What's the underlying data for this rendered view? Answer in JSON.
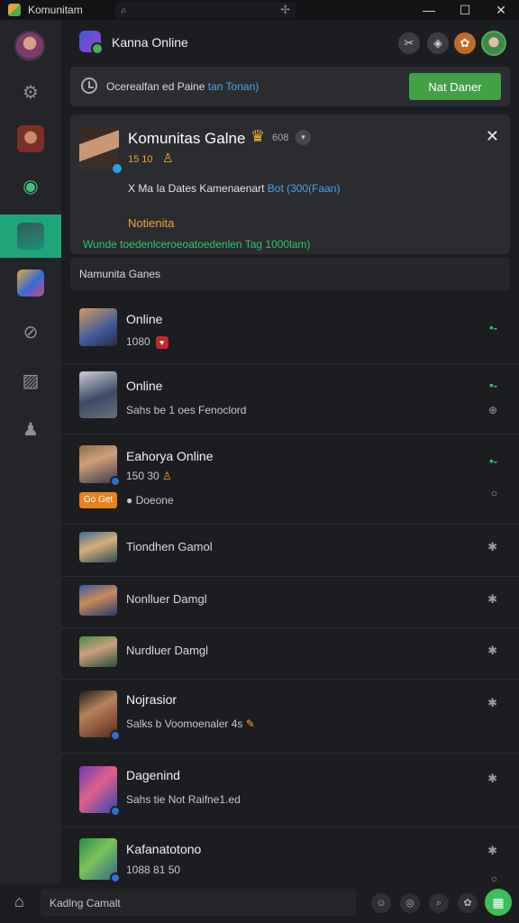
{
  "window": {
    "title": "Komunitam",
    "controls": [
      "—",
      "☐",
      "✕"
    ]
  },
  "header": {
    "title": "Kanna Online"
  },
  "notice": {
    "text": "Ocerealfan ed Paine",
    "link": "tan Tonan)",
    "button": "Nat Daner"
  },
  "card": {
    "title": "Komunitas Galne",
    "meta": "608",
    "stats": "15 10",
    "line1_text": "X Ma Ia Dates Kamenaenart",
    "line1_link": "Bot (300(Faan)",
    "heading": "Notienita",
    "line2": "Wunde toedenlceroeoatoedenlen Tag 1000lam)"
  },
  "section": {
    "title": "Namunita Ganes"
  },
  "list": [
    {
      "name": "Online",
      "sub": "1080",
      "action": "•-"
    },
    {
      "name": "Online",
      "sub": "Sahs be 1 oes Fenoclord",
      "action": "•-",
      "action2": "⊕"
    },
    {
      "name": "Eahorya Online",
      "sub": "150 30",
      "chip": "Go Get",
      "extra": "Doeone",
      "action": "•-",
      "action2": "○"
    },
    {
      "name": "Tiondhen Gamol",
      "action": "✱"
    },
    {
      "name": "Nonlluer Damgl",
      "action": "✱"
    },
    {
      "name": "Nurdluer Damgl",
      "action": "✱"
    },
    {
      "name": "Nojrasior",
      "sub": "Salks b Voomoenaler 4s",
      "action": "✱"
    },
    {
      "name": "Dagenind",
      "sub": "Sahs tie Not Raifne1.ed",
      "action": "✱"
    },
    {
      "name": "Kafanatotono",
      "sub": "1088 81 50",
      "action": "✱",
      "action2": "○"
    }
  ],
  "bottom": {
    "input_text": "Kadlng Camalt"
  },
  "colors": {
    "accent_green": "#1ea67a",
    "button_green": "#43a047",
    "link_blue": "#4aa3e8",
    "orange": "#f0a531"
  }
}
